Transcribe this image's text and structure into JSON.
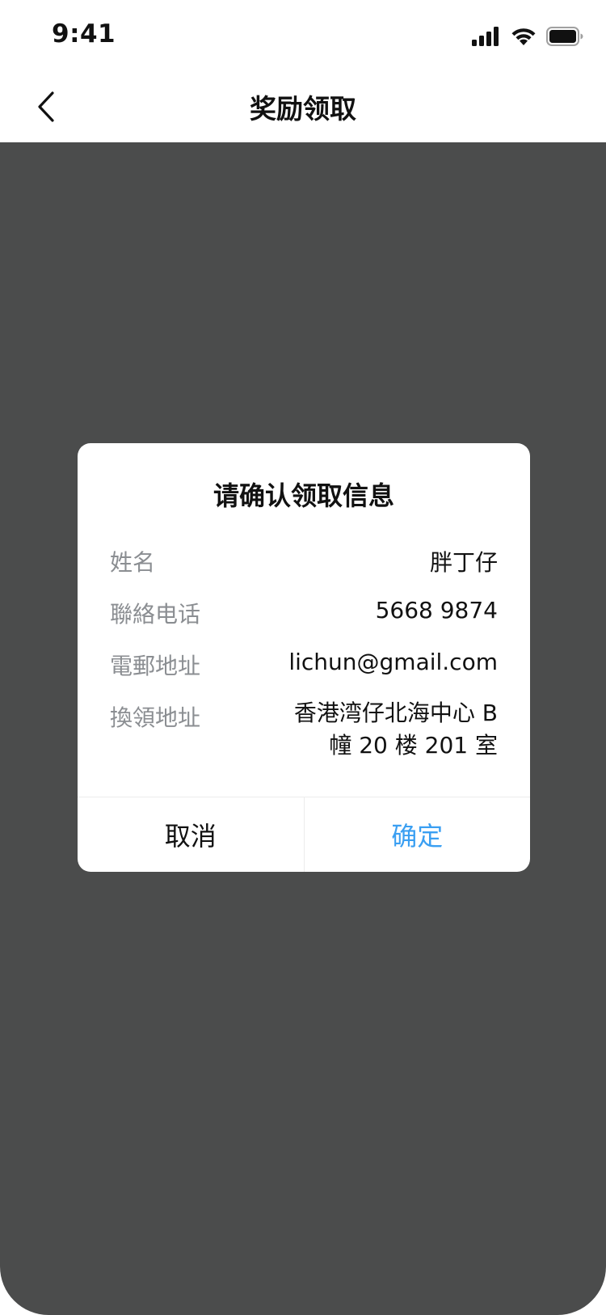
{
  "status_bar": {
    "time": "9:41",
    "icons": [
      "signal-icon",
      "wifi-icon",
      "battery-icon"
    ]
  },
  "nav": {
    "title": "奖励领取",
    "back_icon": "chevron-left-icon"
  },
  "dialog": {
    "title": "请确认领取信息",
    "rows": [
      {
        "label": "姓名",
        "value": "胖丁仔"
      },
      {
        "label": "聯絡电话",
        "value": "5668 9874"
      },
      {
        "label": "電郵地址",
        "value": "lichun@gmail.com"
      },
      {
        "label": "換領地址",
        "value": "香港湾仔北海中心 B 幢 20 楼 201 室"
      }
    ],
    "cancel_label": "取消",
    "confirm_label": "确定"
  },
  "colors": {
    "overlay": "#4b4c4c",
    "accent": "#3a9ff2",
    "label_gray": "#8b8e92"
  }
}
